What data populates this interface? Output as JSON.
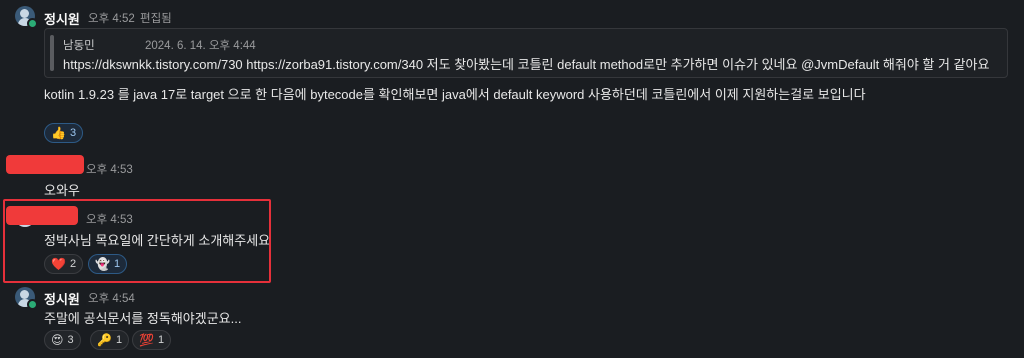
{
  "messages": [
    {
      "author": "정시원",
      "time": "오후 4:52",
      "edited": "편집됨",
      "quote": {
        "author": "남동민",
        "date": "2024. 6. 14. 오후 4:44",
        "text": "https://dkswnkk.tistory.com/730 https://zorba91.tistory.com/340 저도 찾아봤는데 코틀린 default method로만 추가하면 이슈가 있네요 @JvmDefault 해줘야 할 거 같아요"
      },
      "body": "kotlin 1.9.23 를 java 17로 target 으로 한 다음에 bytecode를 확인해보면 java에서 default keyword 사용하던데 코틀린에서 이제 지원하는걸로 보입니다",
      "reactions": [
        {
          "emoji": "👍",
          "emoji_name": "thumbs-up",
          "count": "3"
        }
      ]
    },
    {
      "author": "",
      "time": "오후 4:53",
      "body": "오와우",
      "reactions": []
    },
    {
      "author": "",
      "time": "오후 4:53",
      "body": "정박사님 목요일에 간단하게 소개해주세요",
      "reactions": [
        {
          "emoji": "❤️",
          "emoji_name": "heart",
          "count": "2"
        },
        {
          "emoji": "👻",
          "emoji_name": "ghost",
          "count": "1"
        }
      ]
    },
    {
      "author": "정시원",
      "time": "오후 4:54",
      "body": "주말에 공식문서를 정독해야겠군요...",
      "reactions": [
        {
          "emoji": "😍",
          "emoji_name": "heart-eyes",
          "count": "3"
        },
        {
          "emoji": "🔑",
          "emoji_name": "key-face",
          "count": "1"
        },
        {
          "emoji": "💯",
          "emoji_name": "hundred-points",
          "count": "1"
        }
      ]
    }
  ],
  "colors": {
    "background": "#1a1d21",
    "redaction": "#f03a3a",
    "highlight_box": "#e5303a",
    "presence": "#2bac76"
  }
}
